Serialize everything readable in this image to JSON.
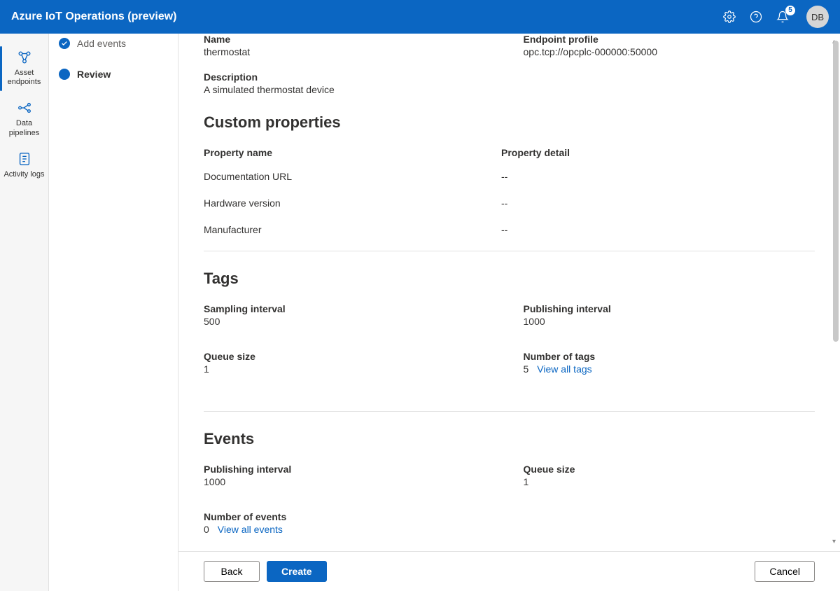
{
  "header": {
    "title": "Azure IoT Operations (preview)",
    "notification_count": "5",
    "avatar_initials": "DB"
  },
  "nav": {
    "items": [
      {
        "label": "Asset endpoints",
        "icon": "endpoints"
      },
      {
        "label": "Data pipelines",
        "icon": "pipelines"
      },
      {
        "label": "Activity logs",
        "icon": "logs"
      }
    ]
  },
  "wizard": {
    "step_complete": "Add events",
    "step_active": "Review"
  },
  "details": {
    "name_label": "Name",
    "name_value": "thermostat",
    "endpoint_label": "Endpoint profile",
    "endpoint_value": "opc.tcp://opcplc-000000:50000",
    "description_label": "Description",
    "description_value": "A simulated thermostat device"
  },
  "custom_props": {
    "heading": "Custom properties",
    "col_name": "Property name",
    "col_detail": "Property detail",
    "rows": [
      {
        "name": "Documentation URL",
        "detail": "--"
      },
      {
        "name": "Hardware version",
        "detail": "--"
      },
      {
        "name": "Manufacturer",
        "detail": "--"
      }
    ]
  },
  "tags": {
    "heading": "Tags",
    "sampling_label": "Sampling interval",
    "sampling_value": "500",
    "publishing_label": "Publishing interval",
    "publishing_value": "1000",
    "queue_label": "Queue size",
    "queue_value": "1",
    "count_label": "Number of tags",
    "count_value": "5",
    "view_link": "View all tags"
  },
  "events": {
    "heading": "Events",
    "publishing_label": "Publishing interval",
    "publishing_value": "1000",
    "queue_label": "Queue size",
    "queue_value": "1",
    "count_label": "Number of events",
    "count_value": "0",
    "view_link": "View all events"
  },
  "footer": {
    "back": "Back",
    "create": "Create",
    "cancel": "Cancel"
  }
}
